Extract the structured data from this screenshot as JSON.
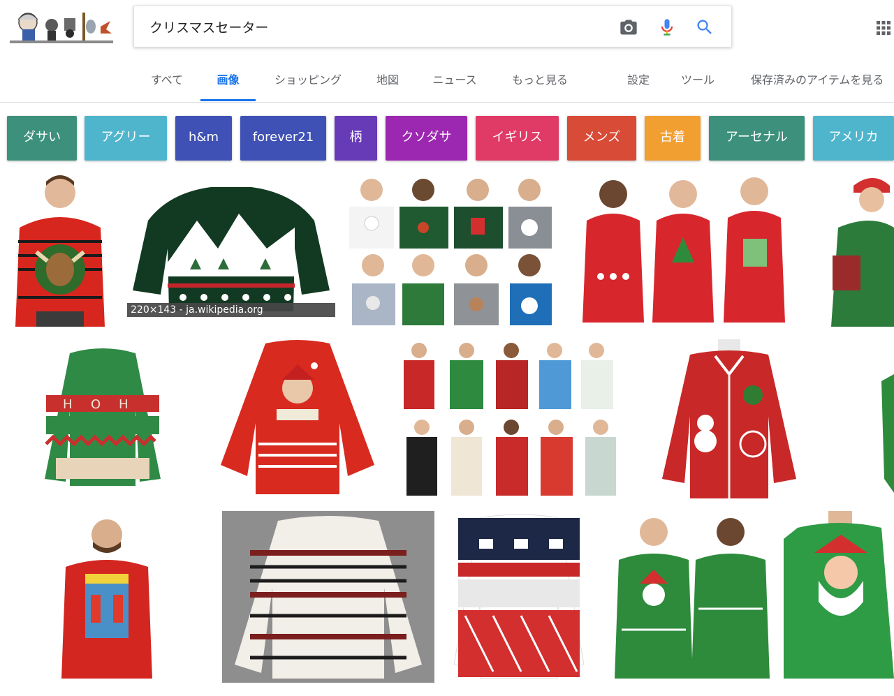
{
  "header": {
    "search": {
      "value": "クリスマスセーター"
    },
    "doodle_icon": "doodle-logo",
    "camera_icon": "camera-icon",
    "mic_icon": "microphone-icon",
    "search_icon": "search-icon",
    "apps_icon": "apps-grid-icon"
  },
  "nav": {
    "tabs": [
      {
        "label": "すべて"
      },
      {
        "label": "画像"
      },
      {
        "label": "ショッピング"
      },
      {
        "label": "地図"
      },
      {
        "label": "ニュース"
      },
      {
        "label": "もっと見る"
      }
    ],
    "settings": "設定",
    "tools": "ツール",
    "saved": "保存済みのアイテムを見る",
    "active_color": "#1a73e8"
  },
  "chips": [
    {
      "label": "ダサい",
      "color": "#3d917c"
    },
    {
      "label": "アグリー",
      "color": "#4fb5cd"
    },
    {
      "label": "h&m",
      "color": "#3f51b5"
    },
    {
      "label": "forever21",
      "color": "#3f51b5"
    },
    {
      "label": "柄",
      "color": "#673ab7"
    },
    {
      "label": "クソダサ",
      "color": "#9c27b0"
    },
    {
      "label": "イギリス",
      "color": "#e03a66"
    },
    {
      "label": "メンズ",
      "color": "#d84b37"
    },
    {
      "label": "古着",
      "color": "#f29f32"
    },
    {
      "label": "アーセナル",
      "color": "#3d917c"
    },
    {
      "label": "アメリカ",
      "color": "#4fb5cd"
    }
  ],
  "results": {
    "caption": "220×143 - ja.wikipedia.org"
  }
}
